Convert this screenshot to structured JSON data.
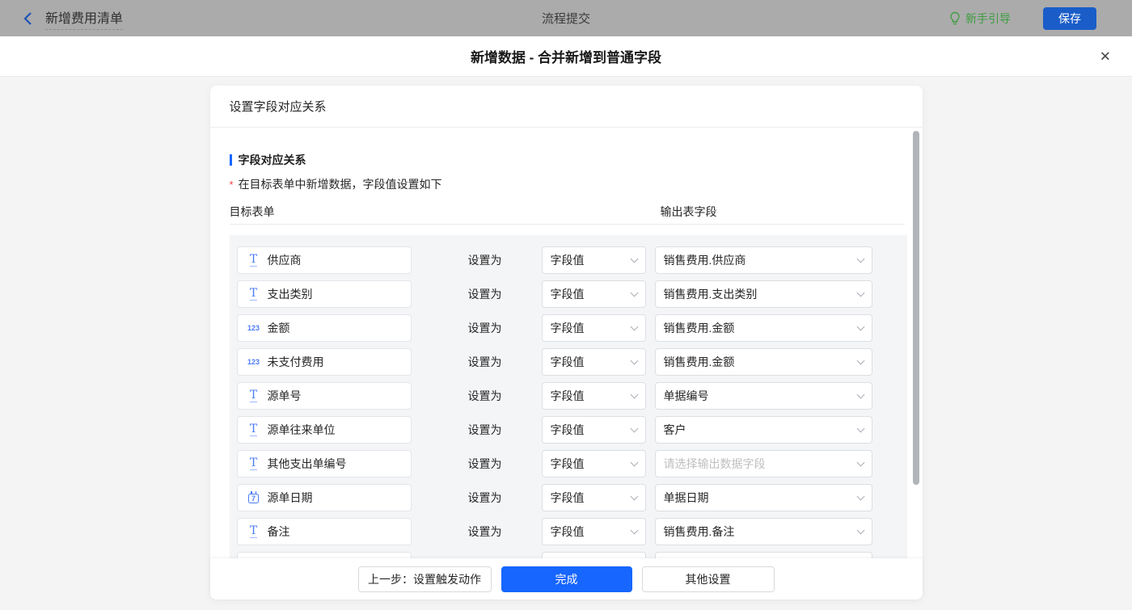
{
  "topbar": {
    "back_title": "新增费用清单",
    "center_title": "流程提交",
    "guide_label": "新手引导",
    "save_label": "保存"
  },
  "modal": {
    "title": "新增数据 - 合并新增到普通字段",
    "close_glyph": "✕"
  },
  "panel": {
    "header_title": "设置字段对应关系",
    "section_title": "字段对应关系",
    "required_mark": "*",
    "note": "在目标表单中新增数据，字段值设置如下",
    "columns": {
      "target_form": "目标表单",
      "output_fields": "输出表字段"
    },
    "set_as_label": "设置为",
    "rows": [
      {
        "type": "text",
        "field": "供应商",
        "method": "字段值",
        "output": "销售费用.供应商",
        "output_is_placeholder": false
      },
      {
        "type": "text",
        "field": "支出类别",
        "method": "字段值",
        "output": "销售费用.支出类别",
        "output_is_placeholder": false
      },
      {
        "type": "number",
        "field": "金额",
        "method": "字段值",
        "output": "销售费用.金额",
        "output_is_placeholder": false
      },
      {
        "type": "number",
        "field": "未支付费用",
        "method": "字段值",
        "output": "销售费用.金额",
        "output_is_placeholder": false
      },
      {
        "type": "text",
        "field": "源单号",
        "method": "字段值",
        "output": "单据编号",
        "output_is_placeholder": false
      },
      {
        "type": "text",
        "field": "源单往来单位",
        "method": "字段值",
        "output": "客户",
        "output_is_placeholder": false
      },
      {
        "type": "text",
        "field": "其他支出单编号",
        "method": "字段值",
        "output": "请选择输出数据字段",
        "output_is_placeholder": true
      },
      {
        "type": "date",
        "field": "源单日期",
        "method": "字段值",
        "output": "单据日期",
        "output_is_placeholder": false
      },
      {
        "type": "text",
        "field": "备注",
        "method": "字段值",
        "output": "销售费用.备注",
        "output_is_placeholder": false
      },
      {
        "type": "none",
        "field": "",
        "method": "",
        "output": "",
        "output_is_placeholder": false,
        "partial": true
      }
    ],
    "footer": {
      "prev_label": "上一步：设置触发动作",
      "done_label": "完成",
      "other_label": "其他设置"
    }
  },
  "icon_glyphs": {
    "text_field": "T",
    "number_field": "123",
    "date_field": "7"
  },
  "colors": {
    "primary_blue": "#1666ff",
    "dimmed_save_blue": "#1a5dc8",
    "guide_green": "#3f9d42",
    "required_red": "#f2413d",
    "field_icon_blue": "#4b7cf5",
    "placeholder_gray": "#bfbfbf"
  }
}
